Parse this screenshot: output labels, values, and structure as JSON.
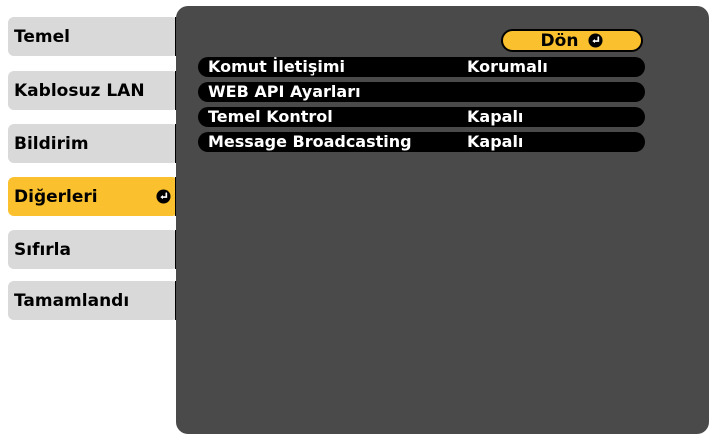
{
  "sidebar": {
    "items": [
      {
        "label": "Temel"
      },
      {
        "label": "Kablosuz LAN"
      },
      {
        "label": "Bildirim"
      },
      {
        "label": "Diğerleri",
        "active": true
      },
      {
        "label": "Sıfırla"
      },
      {
        "label": "Tamamlandı"
      }
    ]
  },
  "panel": {
    "back_label": "Dön",
    "rows": [
      {
        "label": "Komut İletişimi",
        "value": "Korumalı"
      },
      {
        "label": "WEB API Ayarları",
        "value": ""
      },
      {
        "label": "Temel Kontrol",
        "value": "Kapalı"
      },
      {
        "label": "Message Broadcasting",
        "value": "Kapalı"
      }
    ]
  },
  "icons": {
    "enter": "enter-icon"
  },
  "colors": {
    "tab_background": "#d9d9d9",
    "active_accent": "#fbc02d",
    "panel_background": "#4a4a4a",
    "row_background": "#000000",
    "row_text": "#ffffff"
  }
}
